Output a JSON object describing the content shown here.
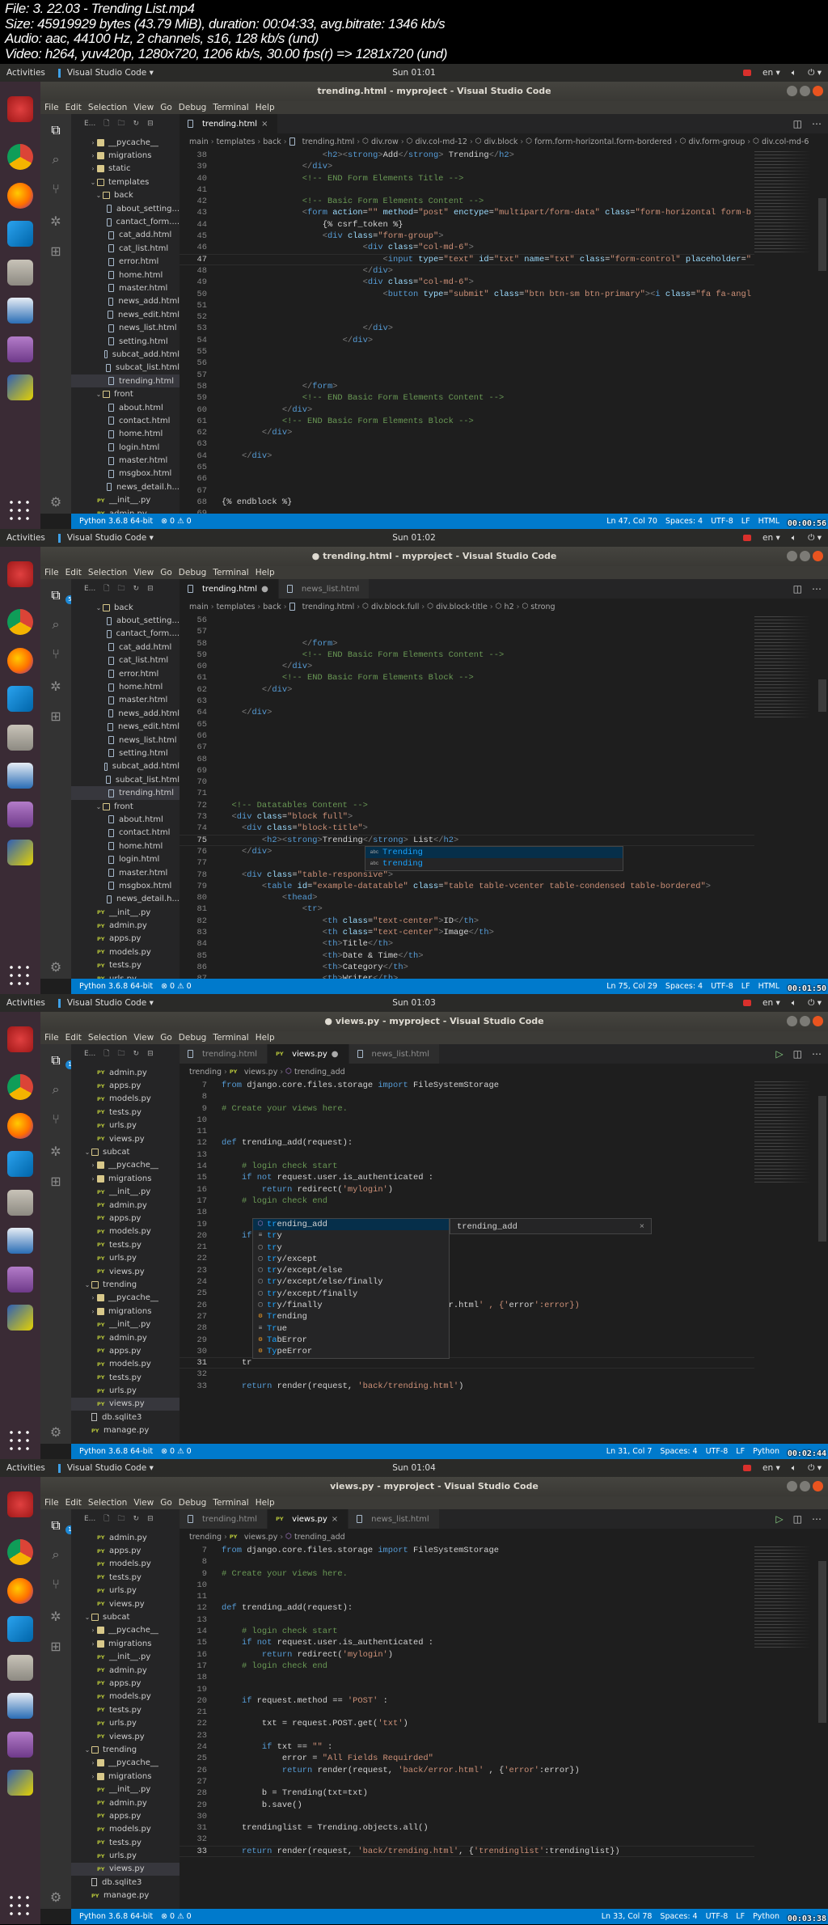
{
  "info": [
    "File: 3. 22.03 - Trending List.mp4",
    "Size: 45919929 bytes (43.79 MiB), duration: 00:04:33, avg.bitrate: 1346 kb/s",
    "Audio: aac, 44100 Hz, 2 channels, s16, 128 kb/s (und)",
    "Video: h264, yuv420p, 1280x720, 1206 kb/s, 30.00 fps(r) => 1281x720 (und)"
  ],
  "system": {
    "activities": "Activities",
    "app": "Visual Studio Code ▾",
    "lang": "en ▾"
  },
  "menu": [
    "File",
    "Edit",
    "Selection",
    "View",
    "Go",
    "Debug",
    "Terminal",
    "Help"
  ],
  "explorer_header": "E...",
  "python_env": "Python 3.6.8 64-bit",
  "problems": {
    "errors": "0",
    "warnings": "0"
  },
  "colors": {
    "status_bar": "#007acc",
    "editor_bg": "#1e1e1e",
    "sidebar_bg": "#252526",
    "launcher_bg": "#3a2b35"
  },
  "frames": [
    {
      "clock": "Sun 01:01",
      "title": "trending.html - myproject - Visual Studio Code",
      "badge": null,
      "tabs": [
        {
          "label": "trending.html",
          "icon": "html",
          "active": true,
          "mark": "×"
        }
      ],
      "run_button": false,
      "breadcrumb": [
        "main",
        "templates",
        "back",
        "trending.html",
        "div.row",
        "div.col-md-12",
        "div.block",
        "form.form-horizontal.form-bordered",
        "div.form-group",
        "div.col-md-6"
      ],
      "tree": [
        [
          2,
          "folder",
          "__pycache__"
        ],
        [
          2,
          "folder",
          "migrations"
        ],
        [
          2,
          "folder",
          "static"
        ],
        [
          2,
          "open",
          "templates"
        ],
        [
          3,
          "open",
          "back"
        ],
        [
          4,
          "html",
          "about_setting..."
        ],
        [
          4,
          "html",
          "cantact_form...."
        ],
        [
          4,
          "html",
          "cat_add.html"
        ],
        [
          4,
          "html",
          "cat_list.html"
        ],
        [
          4,
          "html",
          "error.html"
        ],
        [
          4,
          "html",
          "home.html"
        ],
        [
          4,
          "html",
          "master.html"
        ],
        [
          4,
          "html",
          "news_add.html"
        ],
        [
          4,
          "html",
          "news_edit.html"
        ],
        [
          4,
          "html",
          "news_list.html"
        ],
        [
          4,
          "html",
          "setting.html"
        ],
        [
          4,
          "html",
          "subcat_add.html"
        ],
        [
          4,
          "html",
          "subcat_list.html"
        ],
        [
          4,
          "html",
          "trending.html"
        ],
        [
          3,
          "open",
          "front"
        ],
        [
          4,
          "html",
          "about.html"
        ],
        [
          4,
          "html",
          "contact.html"
        ],
        [
          4,
          "html",
          "home.html"
        ],
        [
          4,
          "html",
          "login.html"
        ],
        [
          4,
          "html",
          "master.html"
        ],
        [
          4,
          "html",
          "msgbox.html"
        ],
        [
          4,
          "html",
          "news_detail.h..."
        ],
        [
          2,
          "py",
          "__init__.py"
        ],
        [
          2,
          "py",
          "admin.py"
        ]
      ],
      "selected": 18,
      "code": {
        "lang": "html",
        "start": 38,
        "active_line": 47,
        "lines": [
          "                    <h2><strong>Add</strong> Trending</h2>",
          "                </div>",
          "                <!-- END Form Elements Title -->",
          "",
          "                <!-- Basic Form Elements Content -->",
          "                <form action=\"\" method=\"post\" enctype=\"multipart/form-data\" class=\"form-horizontal form-b",
          "                    {% csrf_token %}",
          "                    <div class=\"form-group\">",
          "                            <div class=\"col-md-6\">",
          "                                <input type=\"text\" id=\"txt\" name=\"txt\" class=\"form-control\" placeholder=\"",
          "                            </div>",
          "                            <div class=\"col-md-6\">",
          "                                <button type=\"submit\" class=\"btn btn-sm btn-primary\"><i class=\"fa fa-angl",
          "",
          "",
          "                            </div>",
          "                        </div>",
          "",
          "",
          "",
          "                </form>",
          "                <!-- END Basic Form Elements Content -->",
          "            </div>",
          "            <!-- END Basic Form Elements Block -->",
          "        </div>",
          "",
          "    </div>",
          "",
          "",
          "",
          "{% endblock %}",
          ""
        ]
      },
      "suggest": null,
      "status_right": [
        "Ln 47, Col 70",
        "Spaces: 4",
        "UTF-8",
        "LF",
        "HTML"
      ],
      "timestamp": "00:00:56"
    },
    {
      "clock": "Sun 01:02",
      "title": "● trending.html - myproject - Visual Studio Code",
      "badge": "5",
      "tabs": [
        {
          "label": "trending.html",
          "icon": "html",
          "active": true,
          "mark": "●"
        },
        {
          "label": "news_list.html",
          "icon": "html",
          "active": false,
          "mark": ""
        }
      ],
      "run_button": false,
      "breadcrumb": [
        "main",
        "templates",
        "back",
        "trending.html",
        "div.block.full",
        "div.block-title",
        "h2",
        "strong"
      ],
      "tree": [
        [
          3,
          "open",
          "back"
        ],
        [
          4,
          "html",
          "about_setting..."
        ],
        [
          4,
          "html",
          "cantact_form...."
        ],
        [
          4,
          "html",
          "cat_add.html"
        ],
        [
          4,
          "html",
          "cat_list.html"
        ],
        [
          4,
          "html",
          "error.html"
        ],
        [
          4,
          "html",
          "home.html"
        ],
        [
          4,
          "html",
          "master.html"
        ],
        [
          4,
          "html",
          "news_add.html"
        ],
        [
          4,
          "html",
          "news_edit.html"
        ],
        [
          4,
          "html",
          "news_list.html"
        ],
        [
          4,
          "html",
          "setting.html"
        ],
        [
          4,
          "html",
          "subcat_add.html"
        ],
        [
          4,
          "html",
          "subcat_list.html"
        ],
        [
          4,
          "html",
          "trending.html"
        ],
        [
          3,
          "open",
          "front"
        ],
        [
          4,
          "html",
          "about.html"
        ],
        [
          4,
          "html",
          "contact.html"
        ],
        [
          4,
          "html",
          "home.html"
        ],
        [
          4,
          "html",
          "login.html"
        ],
        [
          4,
          "html",
          "master.html"
        ],
        [
          4,
          "html",
          "msgbox.html"
        ],
        [
          4,
          "html",
          "news_detail.h..."
        ],
        [
          2,
          "py",
          "__init__.py"
        ],
        [
          2,
          "py",
          "admin.py"
        ],
        [
          2,
          "py",
          "apps.py"
        ],
        [
          2,
          "py",
          "models.py"
        ],
        [
          2,
          "py",
          "tests.py"
        ],
        [
          2,
          "py",
          "urls.py"
        ]
      ],
      "selected": 14,
      "code": {
        "lang": "html",
        "start": 56,
        "active_line": 75,
        "lines": [
          "",
          "",
          "                </form>",
          "                <!-- END Basic Form Elements Content -->",
          "            </div>",
          "            <!-- END Basic Form Elements Block -->",
          "        </div>",
          "",
          "    </div>",
          "",
          "",
          "",
          "",
          "",
          "",
          "",
          "  <!-- Datatables Content -->",
          "  <div class=\"block full\">",
          "    <div class=\"block-title\">",
          "        <h2><strong>Trending</strong> List</h2>",
          "    </div>",
          "",
          "    <div class=\"table-responsive\">",
          "        <table id=\"example-datatable\" class=\"table table-vcenter table-condensed table-bordered\">",
          "            <thead>",
          "                <tr>",
          "                    <th class=\"text-center\">ID</th>",
          "                    <th class=\"text-center\">Image</th>",
          "                    <th>Title</th>",
          "                    <th>Date & Time</th>",
          "                    <th>Category</th>",
          "                    <th>Writer</th>"
        ]
      },
      "suggest": {
        "items": [
          [
            "word",
            "Trending"
          ],
          [
            "word",
            "trending"
          ]
        ],
        "match_len": 0,
        "detail": null
      },
      "status_right": [
        "Ln 75, Col 29",
        "Spaces: 4",
        "UTF-8",
        "LF",
        "HTML"
      ],
      "timestamp": "00:01:50"
    },
    {
      "clock": "Sun 01:03",
      "title": "● views.py - myproject - Visual Studio Code",
      "badge": "1",
      "tabs": [
        {
          "label": "trending.html",
          "icon": "html",
          "active": false,
          "mark": ""
        },
        {
          "label": "views.py",
          "icon": "py",
          "active": true,
          "mark": "●"
        },
        {
          "label": "news_list.html",
          "icon": "html",
          "active": false,
          "mark": ""
        }
      ],
      "run_button": true,
      "breadcrumb": [
        "trending",
        "views.py",
        "trending_add"
      ],
      "tree": [
        [
          2,
          "py",
          "admin.py"
        ],
        [
          2,
          "py",
          "apps.py"
        ],
        [
          2,
          "py",
          "models.py"
        ],
        [
          2,
          "py",
          "tests.py"
        ],
        [
          2,
          "py",
          "urls.py"
        ],
        [
          2,
          "py",
          "views.py"
        ],
        [
          1,
          "open",
          "subcat"
        ],
        [
          2,
          "folder",
          "__pycache__"
        ],
        [
          2,
          "folder",
          "migrations"
        ],
        [
          2,
          "py",
          "__init__.py"
        ],
        [
          2,
          "py",
          "admin.py"
        ],
        [
          2,
          "py",
          "apps.py"
        ],
        [
          2,
          "py",
          "models.py"
        ],
        [
          2,
          "py",
          "tests.py"
        ],
        [
          2,
          "py",
          "urls.py"
        ],
        [
          2,
          "py",
          "views.py"
        ],
        [
          1,
          "open",
          "trending"
        ],
        [
          2,
          "folder",
          "__pycache__"
        ],
        [
          2,
          "folder",
          "migrations"
        ],
        [
          2,
          "py",
          "__init__.py"
        ],
        [
          2,
          "py",
          "admin.py"
        ],
        [
          2,
          "py",
          "apps.py"
        ],
        [
          2,
          "py",
          "models.py"
        ],
        [
          2,
          "py",
          "tests.py"
        ],
        [
          2,
          "py",
          "urls.py"
        ],
        [
          2,
          "py",
          "views.py"
        ],
        [
          1,
          "db",
          "db.sqlite3"
        ],
        [
          1,
          "py",
          "manage.py"
        ]
      ],
      "selected": 25,
      "code": {
        "lang": "python",
        "start": 7,
        "active_line": 31,
        "lines": [
          "from django.core.files.storage import FileSystemStorage",
          "",
          "# Create your views here.",
          "",
          "",
          "def trending_add(request):",
          "",
          "    # login check start",
          "    if not request.user.is_authenticated :",
          "        return redirect('mylogin')",
          "    # login check end",
          "",
          "",
          "    if",
          "",
          "",
          "",
          "",
          "",
          "                                             r.html' , {'error':error})",
          "",
          "",
          "",
          "",
          "    tr",
          "",
          "    return render(request, 'back/trending.html')"
        ]
      },
      "suggest": {
        "items": [
          [
            "method",
            "trending_add"
          ],
          [
            "keyword",
            "try"
          ],
          [
            "snippet",
            "try"
          ],
          [
            "snippet",
            "try/except"
          ],
          [
            "snippet",
            "try/except/else"
          ],
          [
            "snippet",
            "try/except/else/finally"
          ],
          [
            "snippet",
            "try/except/finally"
          ],
          [
            "snippet",
            "try/finally"
          ],
          [
            "class",
            "Trending"
          ],
          [
            "keyword",
            "True"
          ],
          [
            "class",
            "TabError"
          ],
          [
            "class",
            "TypeError"
          ]
        ],
        "match_len": 2,
        "detail": "trending_add",
        "close": "×"
      },
      "status_right": [
        "Ln 31, Col 7",
        "Spaces: 4",
        "UTF-8",
        "LF",
        "Python"
      ],
      "timestamp": "00:02:44"
    },
    {
      "clock": "Sun 01:04",
      "title": "views.py - myproject - Visual Studio Code",
      "badge": "1",
      "tabs": [
        {
          "label": "trending.html",
          "icon": "html",
          "active": false,
          "mark": ""
        },
        {
          "label": "views.py",
          "icon": "py",
          "active": true,
          "mark": "×"
        },
        {
          "label": "news_list.html",
          "icon": "html",
          "active": false,
          "mark": ""
        }
      ],
      "run_button": true,
      "breadcrumb": [
        "trending",
        "views.py",
        "trending_add"
      ],
      "tree": [
        [
          2,
          "py",
          "admin.py"
        ],
        [
          2,
          "py",
          "apps.py"
        ],
        [
          2,
          "py",
          "models.py"
        ],
        [
          2,
          "py",
          "tests.py"
        ],
        [
          2,
          "py",
          "urls.py"
        ],
        [
          2,
          "py",
          "views.py"
        ],
        [
          1,
          "open",
          "subcat"
        ],
        [
          2,
          "folder",
          "__pycache__"
        ],
        [
          2,
          "folder",
          "migrations"
        ],
        [
          2,
          "py",
          "__init__.py"
        ],
        [
          2,
          "py",
          "admin.py"
        ],
        [
          2,
          "py",
          "apps.py"
        ],
        [
          2,
          "py",
          "models.py"
        ],
        [
          2,
          "py",
          "tests.py"
        ],
        [
          2,
          "py",
          "urls.py"
        ],
        [
          2,
          "py",
          "views.py"
        ],
        [
          1,
          "open",
          "trending"
        ],
        [
          2,
          "folder",
          "__pycache__"
        ],
        [
          2,
          "folder",
          "migrations"
        ],
        [
          2,
          "py",
          "__init__.py"
        ],
        [
          2,
          "py",
          "admin.py"
        ],
        [
          2,
          "py",
          "apps.py"
        ],
        [
          2,
          "py",
          "models.py"
        ],
        [
          2,
          "py",
          "tests.py"
        ],
        [
          2,
          "py",
          "urls.py"
        ],
        [
          2,
          "py",
          "views.py"
        ],
        [
          1,
          "db",
          "db.sqlite3"
        ],
        [
          1,
          "py",
          "manage.py"
        ]
      ],
      "selected": 25,
      "code": {
        "lang": "python",
        "start": 7,
        "active_line": 33,
        "lines": [
          "from django.core.files.storage import FileSystemStorage",
          "",
          "# Create your views here.",
          "",
          "",
          "def trending_add(request):",
          "",
          "    # login check start",
          "    if not request.user.is_authenticated :",
          "        return redirect('mylogin')",
          "    # login check end",
          "",
          "",
          "    if request.method == 'POST' :",
          "",
          "        txt = request.POST.get('txt')",
          "",
          "        if txt == \"\" :",
          "            error = \"All Fields Requirded\"",
          "            return render(request, 'back/error.html' , {'error':error})",
          "",
          "        b = Trending(txt=txt)",
          "        b.save()",
          "",
          "    trendinglist = Trending.objects.all()",
          "",
          "    return render(request, 'back/trending.html', {'trendinglist':trendinglist})"
        ]
      },
      "suggest": null,
      "status_right": [
        "Ln 33, Col 78",
        "Spaces: 4",
        "UTF-8",
        "LF",
        "Python"
      ],
      "timestamp": "00:03:38"
    }
  ]
}
